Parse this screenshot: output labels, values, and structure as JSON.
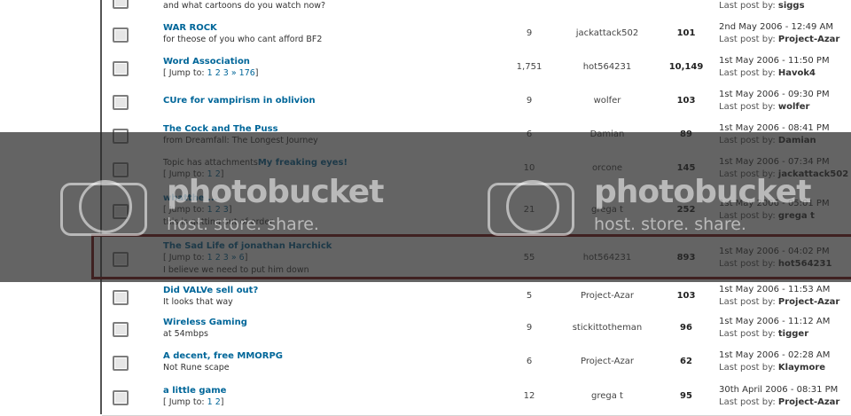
{
  "topics": [
    {
      "title": "",
      "desc": "and what cartoons do you watch now?",
      "jump": null,
      "attachment_label": null,
      "replies": "",
      "author": "",
      "views": "",
      "last_date": "",
      "last_by_label": "Last post by:",
      "last_by": "siggs"
    },
    {
      "title": "WAR ROCK",
      "desc": "for theose of you who cant afford BF2",
      "jump": null,
      "attachment_label": null,
      "replies": "9",
      "author": "jackattack502",
      "views": "101",
      "last_date": "2nd May 2006 - 12:49 AM",
      "last_by_label": "Last post by:",
      "last_by": "Project-Azar"
    },
    {
      "title": "Word Association",
      "desc": null,
      "jump": {
        "label": "[ Jump to: ",
        "pages": "1 2 3 » 176",
        "end": "]"
      },
      "attachment_label": null,
      "replies": "1,751",
      "author": "hot564231",
      "views": "10,149",
      "last_date": "1st May 2006 - 11:50 PM",
      "last_by_label": "Last post by:",
      "last_by": "Havok4"
    },
    {
      "title": "CUre for vampirism in oblivion",
      "desc": null,
      "jump": null,
      "attachment_label": null,
      "replies": "9",
      "author": "wolfer",
      "views": "103",
      "last_date": "1st May 2006 - 09:30 PM",
      "last_by_label": "Last post by:",
      "last_by": "wolfer"
    },
    {
      "title": "The Cock and The Puss",
      "desc": "from Dreamfall: The Longest Journey",
      "jump": null,
      "attachment_label": null,
      "replies": "6",
      "author": "Damian",
      "views": "89",
      "last_date": "1st May 2006 - 08:41 PM",
      "last_by_label": "Last post by:",
      "last_by": "Damian"
    },
    {
      "title": "My freaking eyes!",
      "desc": null,
      "jump": {
        "label": "[ Jump to: ",
        "pages": "1 2",
        "end": "]"
      },
      "attachment_label": "Topic has attachments",
      "replies": "10",
      "author": "orcone",
      "views": "145",
      "last_date": "1st May 2006 - 07:34 PM",
      "last_by_label": "Last post by:",
      "last_by": "jackattack502"
    },
    {
      "title": "whatthe ...",
      "desc": "this is getting out of order",
      "jump": {
        "label": "[ Jump to: ",
        "pages": "1 2 3",
        "end": "]"
      },
      "attachment_label": null,
      "replies": "21",
      "author": "grega t",
      "views": "252",
      "last_date": "1st May 2006 - 05:01 PM",
      "last_by_label": "Last post by:",
      "last_by": "grega t"
    },
    {
      "title": "The Sad Life of jonathan Harchick",
      "desc": "I believe we need to put him down",
      "jump": {
        "label": "[ Jump to: ",
        "pages": "1 2 3 » 6",
        "end": "]"
      },
      "attachment_label": null,
      "replies": "55",
      "author": "hot564231",
      "views": "893",
      "last_date": "1st May 2006 - 04:02 PM",
      "last_by_label": "Last post by:",
      "last_by": "hot564231"
    },
    {
      "title": "Did VALVe sell out?",
      "desc": "It looks that way",
      "jump": null,
      "attachment_label": null,
      "replies": "5",
      "author": "Project-Azar",
      "views": "103",
      "last_date": "1st May 2006 - 11:53 AM",
      "last_by_label": "Last post by:",
      "last_by": "Project-Azar"
    },
    {
      "title": "Wireless Gaming",
      "desc": "at 54mbps",
      "jump": null,
      "attachment_label": null,
      "replies": "9",
      "author": "stickittotheman",
      "views": "96",
      "last_date": "1st May 2006 - 11:12 AM",
      "last_by_label": "Last post by:",
      "last_by": "tigger"
    },
    {
      "title": "A decent, free MMORPG",
      "desc": "Not Rune scape",
      "jump": null,
      "attachment_label": null,
      "replies": "6",
      "author": "Project-Azar",
      "views": "62",
      "last_date": "1st May 2006 - 02:28 AM",
      "last_by_label": "Last post by:",
      "last_by": "Klaymore"
    },
    {
      "title": "a little game",
      "desc": null,
      "jump": {
        "label": "[ Jump to: ",
        "pages": "1 2",
        "end": "]"
      },
      "attachment_label": null,
      "replies": "12",
      "author": "grega t",
      "views": "95",
      "last_date": "30th April 2006 - 08:31 PM",
      "last_by_label": "Last post by:",
      "last_by": "Project-Azar"
    }
  ],
  "watermark": {
    "brand": "photobucket",
    "tagline": "host. store. share."
  },
  "colors": {
    "title_link": "#006699",
    "highlight_border": "#7a1010",
    "overlay": "#282828"
  }
}
